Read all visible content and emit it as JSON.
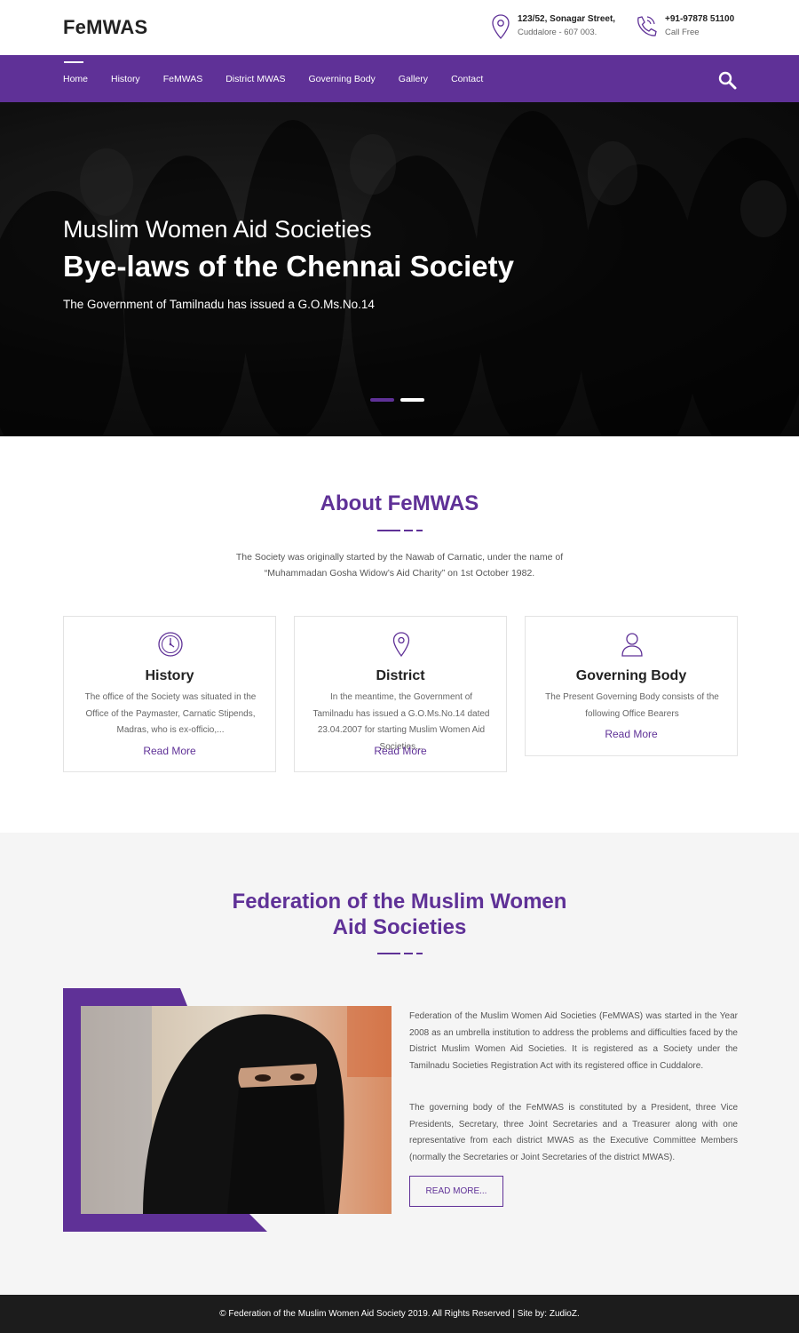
{
  "header": {
    "logo": "FeMWAS",
    "address": {
      "line1": "123/52, Sonagar Street,",
      "line2": "Cuddalore - 607 003."
    },
    "phone": {
      "line1": "+91-97878 51100",
      "line2": "Call Free"
    }
  },
  "nav": {
    "items": [
      {
        "label": "Home",
        "active": true
      },
      {
        "label": "History"
      },
      {
        "label": "FeMWAS"
      },
      {
        "label": "District MWAS"
      },
      {
        "label": "Governing Body"
      },
      {
        "label": "Gallery"
      },
      {
        "label": "Contact"
      }
    ],
    "search_icon": "search-icon"
  },
  "hero": {
    "subtitle": "Muslim Women Aid Societies",
    "title": "Bye-laws of the Chennai Society",
    "text": "The Government of Tamilnadu has issued a G.O.Ms.No.14",
    "slides": 2,
    "active_slide": 1
  },
  "about": {
    "title": "About FeMWAS",
    "text_line1": "The Society was originally started by the Nawab of Carnatic, under the name of",
    "text_line2": "“Muhammadan Gosha Widow’s Aid Charity” on 1st October 1982.",
    "cards": [
      {
        "icon": "clock-icon",
        "title": "History",
        "text": "The office of the Society was situated in the Office of the Paymaster, Carnatic Stipends, Madras, who is ex-officio,...",
        "link": "Read More"
      },
      {
        "icon": "map-pin-icon",
        "title": "District",
        "text": "In the meantime, the Government of Tamilnadu has issued a G.O.Ms.No.14 dated 23.04.2007 for starting Muslim Women Aid Societies...",
        "link": "Read More"
      },
      {
        "icon": "user-icon",
        "title": "Governing Body",
        "text": "The Present Governing Body consists of the following Office Bearers",
        "link": "Read More"
      }
    ]
  },
  "federation": {
    "title_line1": "Federation of the Muslim Women",
    "title_line2": "Aid Societies",
    "para1": "Federation of the Muslim Women Aid Societies (FeMWAS) was started in the Year 2008 as an umbrella institution to address the problems and difficulties faced by the District Muslim Women Aid Societies. It is registered as a Society under the Tamilnadu Societies Registration Act with its registered office in Cuddalore.",
    "para2": "The governing body of the FeMWAS is constituted by a President, three Vice Presidents, Secretary, three Joint Secretaries and a Treasurer along with one representative from each district MWAS as the Executive Committee Members (normally the Secretaries or Joint Secretaries of the district MWAS).",
    "button": "READ MORE..."
  },
  "footer": {
    "text": "© Federation of the Muslim Women Aid Society 2019. All Rights Reserved | Site by: ZudioZ."
  },
  "colors": {
    "accent": "#5f3197",
    "footer_bg": "#1c1c1c",
    "section_bg": "#f5f5f5"
  }
}
